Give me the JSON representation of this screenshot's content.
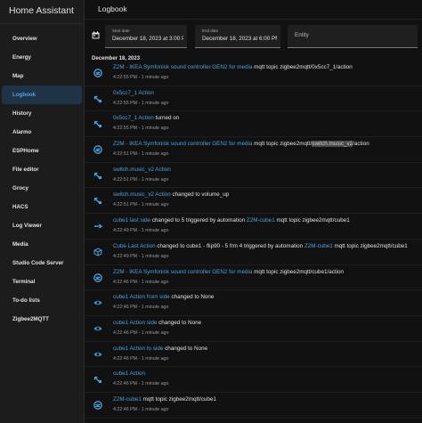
{
  "sidebar": {
    "title": "Home Assistant",
    "items": [
      {
        "label": "Overview",
        "active": false
      },
      {
        "label": "Energy",
        "active": false
      },
      {
        "label": "Map",
        "active": false
      },
      {
        "label": "Logbook",
        "active": true
      },
      {
        "label": "History",
        "active": false
      },
      {
        "label": "Alarmo",
        "active": false
      },
      {
        "label": "ESPHome",
        "active": false
      },
      {
        "label": "File editor",
        "active": false
      },
      {
        "label": "Grocy",
        "active": false
      },
      {
        "label": "HACS",
        "active": false
      },
      {
        "label": "Log Viewer",
        "active": false
      },
      {
        "label": "Media",
        "active": false
      },
      {
        "label": "Studio Code Server",
        "active": false
      },
      {
        "label": "Terminal",
        "active": false
      },
      {
        "label": "To-do lists",
        "active": false
      },
      {
        "label": "Zigbee2MQTT",
        "active": false
      }
    ]
  },
  "header": {
    "title": "Logbook"
  },
  "filters": {
    "start": {
      "label": "Start date",
      "value": "December 18, 2023 at 3:00 PM"
    },
    "end": {
      "label": "End date",
      "value": "December 18, 2023 at 6:00 PM"
    },
    "entity": {
      "placeholder": "Entity"
    }
  },
  "date_header": "December 18, 2023",
  "colors": {
    "accent": "#4aa3e0",
    "active_bg": "#1f3347",
    "background": "#111111"
  },
  "entries": [
    {
      "icon": "zigbee-icon",
      "l1": "Z2M - IKEA Symfonisk sound controller GEN2 for media",
      "l2": " mqtt topic zigbee2mqtt/0x5cc7_1/action",
      "l3": "",
      "l4": "",
      "time": "4:22:55 PM - 1 minute ago"
    },
    {
      "icon": "remote-icon",
      "l1": "0x5cc7_1 Action",
      "l2": "",
      "l3": "",
      "l4": "",
      "time": "4:22:55 PM - 1 minute ago"
    },
    {
      "icon": "remote-icon",
      "l1": "0x5cc7_1 Action",
      "l2": " turned on",
      "l3": "",
      "l4": "",
      "time": "4:22:55 PM - 1 minute ago"
    },
    {
      "icon": "zigbee-icon",
      "l1": "Z2M - IKEA Symfonisk sound controller GEN2 for media",
      "l2": " mqtt topic zigbee2mqtt/",
      "l3": "switch.music_v2",
      "l4": "/action",
      "time": "4:22:51 PM - 1 minute ago"
    },
    {
      "icon": "remote-icon",
      "l1": "switch.music_v2 Action",
      "l2": "",
      "l3": "",
      "l4": "",
      "time": "4:22:51 PM - 1 minute ago"
    },
    {
      "icon": "remote-icon",
      "l1": "switch.music_v2 Action",
      "l2": " changed to volume_up",
      "l3": "",
      "l4": "",
      "time": "4:22:51 PM - 1 minute ago"
    },
    {
      "icon": "arrow-icon",
      "l1": "cube1 last side",
      "l2": " changed to 5 triggered by automation ",
      "l3": "Z2M-cube1",
      "l4": " mqtt topic zigbee2mqtt/cube1",
      "time": "4:22:49 PM - 1 minute ago"
    },
    {
      "icon": "cube-icon",
      "l1": "Cube Last Action",
      "l2": " changed to cube1 - flip90 - 5 frm 4 triggered by automation ",
      "l3": "Z2M-cube1",
      "l4": " mqtt topic zigbee2mqtt/cube1",
      "time": "4:22:49 PM - 1 minute ago"
    },
    {
      "icon": "zigbee-icon",
      "l1": "Z2M - IKEA Symfonisk sound controller GEN2 for media",
      "l2": " mqtt topic zigbee2mqtt/cube1/action",
      "l3": "",
      "l4": "",
      "time": "4:22:46 PM - 1 minute ago"
    },
    {
      "icon": "eye-icon",
      "l1": "cube1 Action from side",
      "l2": " changed to None",
      "l3": "",
      "l4": "",
      "time": "4:22:46 PM - 1 minute ago"
    },
    {
      "icon": "eye-icon",
      "l1": "cube1 Action side",
      "l2": " changed to None",
      "l3": "",
      "l4": "",
      "time": "4:22:46 PM - 1 minute ago"
    },
    {
      "icon": "eye-icon",
      "l1": "cube1 Action to side",
      "l2": " changed to None",
      "l3": "",
      "l4": "",
      "time": "4:22:46 PM - 1 minute ago"
    },
    {
      "icon": "remote-icon",
      "l1": "cube1 Action",
      "l2": "",
      "l3": "",
      "l4": "",
      "time": "4:22:46 PM - 1 minute ago"
    },
    {
      "icon": "zigbee-icon",
      "l1": "Z2M-cube1",
      "l2": " mqtt topic zigbee2mqtt/cube1",
      "l3": "",
      "l4": "",
      "time": "4:22:46 PM - 1 minute ago"
    }
  ]
}
